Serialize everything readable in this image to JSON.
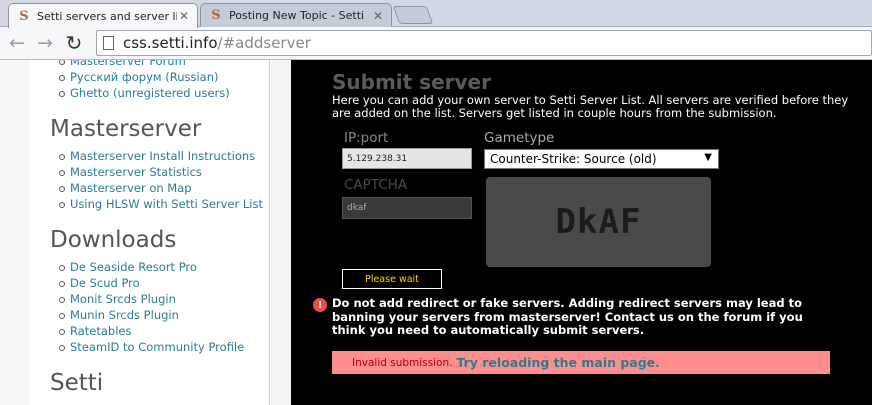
{
  "tabs": [
    {
      "title": "Setti servers and server lists",
      "favicon": "S",
      "active": true
    },
    {
      "title": "Posting New Topic - Setti",
      "favicon": "S",
      "active": false
    }
  ],
  "toolbar": {
    "url_host": "css.setti.info",
    "url_path": "/#addserver"
  },
  "sidebar": {
    "top_links": [
      "Masterserver Forum",
      "Русский форум (Russian)",
      "Ghetto (unregistered users)"
    ],
    "sections": [
      {
        "heading": "Masterserver",
        "links": [
          "Masterserver Install Instructions",
          "Masterserver Statistics",
          "Masterserver on Map",
          "Using HLSW with Setti Server List"
        ]
      },
      {
        "heading": "Downloads",
        "links": [
          "De Seaside Resort Pro",
          "De Scud Pro",
          "Monit Srcds Plugin",
          "Munin Srcds Plugin",
          "Ratetables",
          "SteamID to Community Profile"
        ]
      },
      {
        "heading": "Setti",
        "links": []
      }
    ]
  },
  "form": {
    "title": "Submit server",
    "intro": "Here you can add your own server to Setti Server List. All servers are verified before they are added on the list. Servers get listed in couple hours from the submission.",
    "ip_label": "IP:port",
    "ip_value": "5.129.238.31",
    "gametype_label": "Gametype",
    "gametype_value": "Counter-Strike: Source (old)",
    "captcha_label": "CAPTCHA",
    "captcha_value": "dkaf",
    "captcha_image_text": "DkAF",
    "wait_button": "Please wait",
    "warning": "Do not add redirect or fake servers. Adding redirect servers may lead to banning your servers from masterserver! Contact us on the forum if you think you need to automatically submit servers.",
    "error_prefix": "Invalid submission.",
    "error_link": "Try reloading the main page."
  },
  "colors": {
    "link": "#2a7d93",
    "wait_text": "#ffd400",
    "error_bg": "#ff8f8f",
    "warning_icon": "#ee4e4e"
  }
}
